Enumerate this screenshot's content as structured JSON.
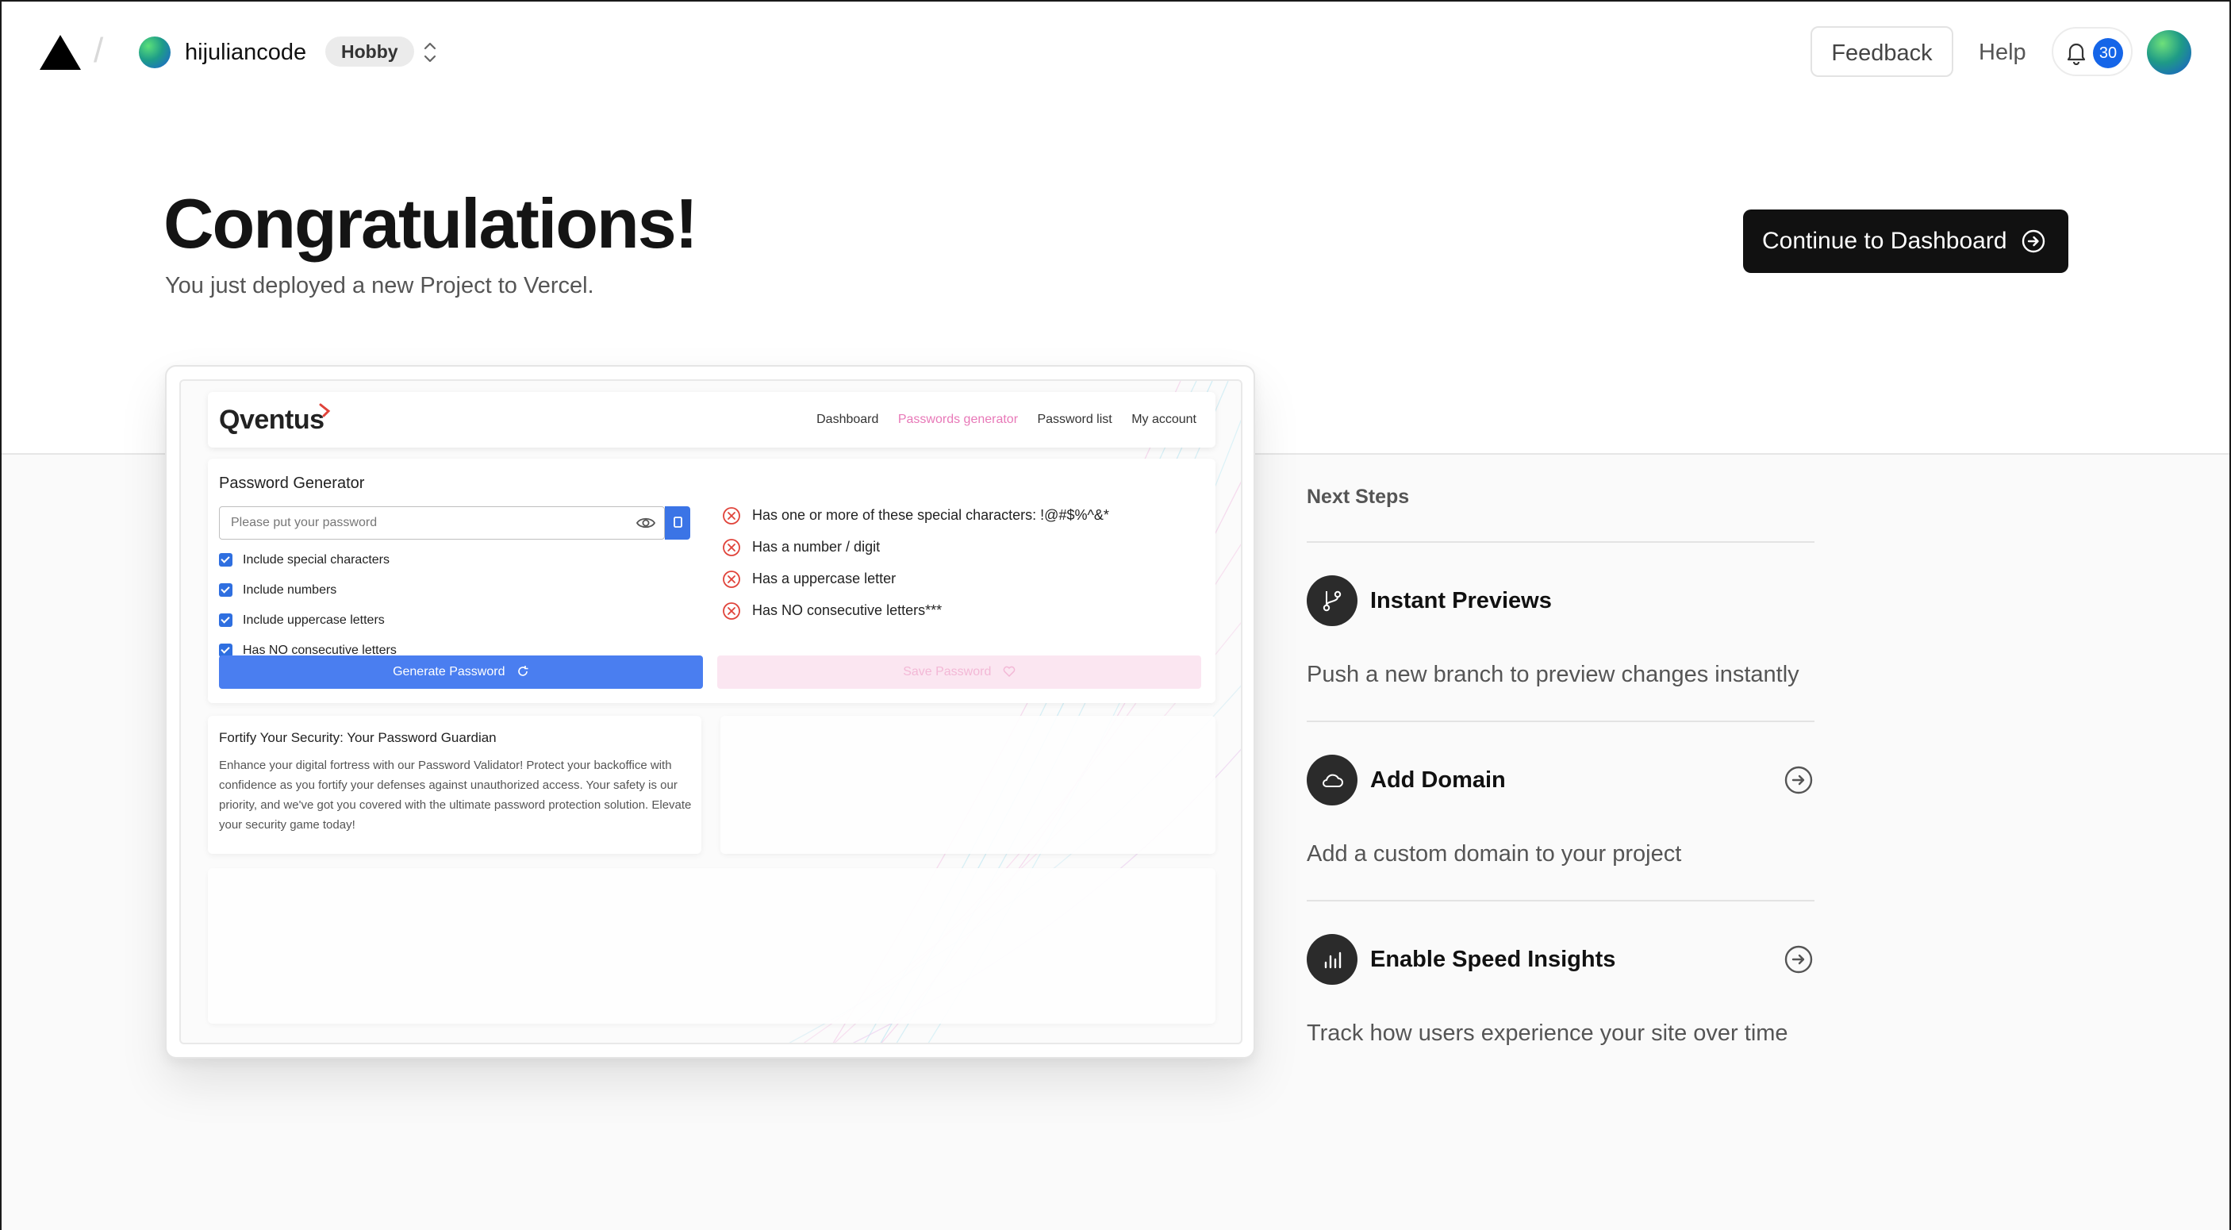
{
  "header": {
    "team_name": "hijuliancode",
    "plan": "Hobby",
    "feedback_label": "Feedback",
    "help_label": "Help",
    "notification_count": "30"
  },
  "hero": {
    "title": "Congratulations!",
    "subtitle": "You just deployed a new Project to Vercel.",
    "continue_label": "Continue to Dashboard"
  },
  "preview": {
    "app_logo": "Qventus",
    "nav": [
      "Dashboard",
      "Passwords generator",
      "Password list",
      "My account"
    ],
    "panel_title": "Password Generator",
    "input_placeholder": "Please put your password",
    "options": [
      "Include special characters",
      "Include numbers",
      "Include uppercase letters",
      "Has NO consecutive letters"
    ],
    "rules": [
      "Has one or more of these special characters: !@#$%^&*",
      "Has a number / digit",
      "Has a uppercase letter",
      "Has NO consecutive letters***"
    ],
    "generate_label": "Generate Password",
    "save_label": "Save Password",
    "info_title": "Fortify Your Security: Your Password Guardian",
    "info_text": "Enhance your digital fortress with our Password Validator! Protect your backoffice with confidence as you fortify your defenses against unauthorized access. Your safety is our priority, and we've got you covered with the ultimate password protection solution. Elevate your security game today!"
  },
  "next_steps": {
    "heading": "Next Steps",
    "items": [
      {
        "title": "Instant Previews",
        "description": "Push a new branch to preview changes instantly",
        "icon": "git-branch-icon"
      },
      {
        "title": "Add Domain",
        "description": "Add a custom domain to your project",
        "icon": "cloud-icon"
      },
      {
        "title": "Enable Speed Insights",
        "description": "Track how users experience your site over time",
        "icon": "bar-chart-icon"
      }
    ]
  },
  "colors": {
    "accent_blue": "#1565e8",
    "primary_button": "#111111",
    "preview_pink": "#e879b8"
  }
}
